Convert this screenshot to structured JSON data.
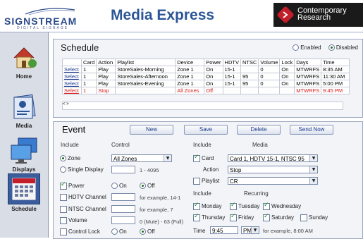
{
  "header": {
    "logo_text": "SIGNSTREAM",
    "logo_sub": "DIGITAL SIGNAGE",
    "app_title": "Media Express",
    "brand_line1": "Contemporary",
    "brand_line2": "Research"
  },
  "sidebar": {
    "items": [
      {
        "label": "Home",
        "icon": "home-icon"
      },
      {
        "label": "Media",
        "icon": "media-icon"
      },
      {
        "label": "Displays",
        "icon": "displays-icon"
      },
      {
        "label": "Schedule",
        "icon": "schedule-icon",
        "active": true
      }
    ]
  },
  "schedule": {
    "title": "Schedule",
    "enabled_label": "Enabled",
    "disabled_label": "Disabled",
    "columns": [
      "",
      "Card",
      "Action",
      "Playlist",
      "Device",
      "Power",
      "HDTV",
      "NTSC",
      "Volume",
      "Lock",
      "Days",
      "Time"
    ],
    "rows": [
      {
        "select": "Select",
        "card": "1",
        "action": "Play",
        "playlist": "StoreSales-Morning",
        "device": "Zone 1",
        "power": "On",
        "hdtv": "15-1",
        "ntsc": "",
        "volume": "0",
        "lock": "On",
        "days": "MTWRFS",
        "time": "8:35 AM",
        "highlight": false
      },
      {
        "select": "Select",
        "card": "1",
        "action": "Play",
        "playlist": "StoreSales-Afternoon",
        "device": "Zone 1",
        "power": "On",
        "hdtv": "15-1",
        "ntsc": "95",
        "volume": "0",
        "lock": "On",
        "days": "MTWRFS",
        "time": "11:30 AM",
        "highlight": false
      },
      {
        "select": "Select",
        "card": "1",
        "action": "Play",
        "playlist": "StoreSales-Evening",
        "device": "Zone 1",
        "power": "On",
        "hdtv": "15-1",
        "ntsc": "95",
        "volume": "0",
        "lock": "On",
        "days": "MTWRFS",
        "time": "5:00 PM",
        "highlight": false
      },
      {
        "select": "Select",
        "card": "1",
        "action": "Stop",
        "playlist": "",
        "device": "All Zones",
        "power": "Off",
        "hdtv": "",
        "ntsc": "",
        "volume": "",
        "lock": "",
        "days": "MTWRFS",
        "time": "9:45 PM",
        "highlight": true
      }
    ],
    "scroll_text": "< >"
  },
  "event": {
    "title": "Event",
    "buttons": {
      "new": "New",
      "save": "Save",
      "delete": "Delete",
      "send_now": "Send Now"
    },
    "include_label": "Include",
    "control_label": "Control",
    "zone_label": "Zone",
    "zone_value": "All Zones",
    "single_display_label": "Single Display",
    "single_display_range": "1 - 4095",
    "power_label": "Power",
    "on_label": "On",
    "off_label": "Off",
    "hdtv_label": "HDTV Channel",
    "hdtv_hint": "for example, 14-1",
    "ntsc_label": "NTSC Channel",
    "ntsc_hint": "for example, 7",
    "volume_label": "Volume",
    "volume_hint": "0 (Mute) - 63 (Full)",
    "control_lock_label": "Control Lock",
    "include_label2": "Include",
    "media_label": "Media",
    "card_label": "Card",
    "card_value": "Card 1, HDTV 15-1, NTSC 95",
    "action_label": "Action",
    "action_value": "Stop",
    "playlist_label": "Playlist",
    "playlist_value": "CR",
    "include_label3": "Include",
    "recurring_label": "Recurring",
    "days": {
      "monday": "Monday",
      "tuesday": "Tuesday",
      "wednesday": "Wednesday",
      "thursday": "Thursday",
      "friday": "Friday",
      "saturday": "Saturday",
      "sunday": "Sunday"
    },
    "time_label": "Time",
    "time_value": "9:45",
    "ampm_value": "PM",
    "time_hint": "for example, 8:00 AM"
  },
  "colors": {
    "accent": "#2c5597",
    "highlight_row": "#d81a1a",
    "sidebar_bg": "#d9dde6"
  }
}
